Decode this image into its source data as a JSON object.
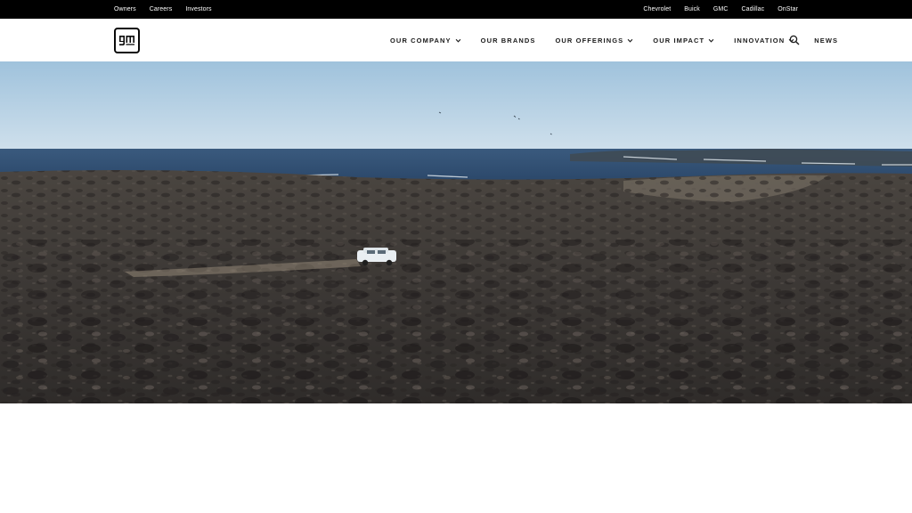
{
  "utility_nav": {
    "left_links": [
      "Owners",
      "Careers",
      "Investors"
    ],
    "right_links": [
      "Chevrolet",
      "Buick",
      "GMC",
      "Cadillac",
      "OnStar"
    ]
  },
  "brand": {
    "logo_text": "gm"
  },
  "main_nav": {
    "items": [
      {
        "label": "OUR COMPANY",
        "has_dropdown": true
      },
      {
        "label": "OUR BRANDS",
        "has_dropdown": false
      },
      {
        "label": "OUR OFFERINGS",
        "has_dropdown": true
      },
      {
        "label": "OUR IMPACT",
        "has_dropdown": true
      },
      {
        "label": "INNOVATION",
        "has_dropdown": true
      },
      {
        "label": "NEWS",
        "has_dropdown": false
      }
    ],
    "search_icon": "search-icon"
  },
  "hero": {
    "media": "video-still",
    "colors": {
      "sky_top": "#a8c8e0",
      "sky_bottom": "#c9dceb",
      "sea": "#2f4f73",
      "ground": "#3b3734"
    }
  }
}
